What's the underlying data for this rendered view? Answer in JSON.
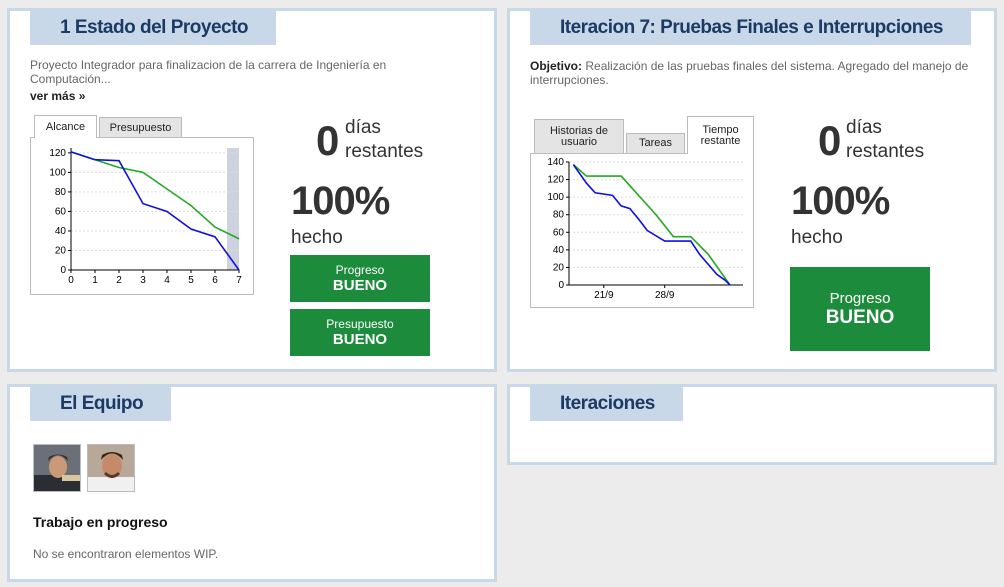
{
  "project_panel": {
    "title": "1 Estado del Proyecto",
    "description": "Proyecto Integrador para finalizacion de la carrera de Ingeniería en Computación...",
    "more_link": "ver más »",
    "tabs": [
      "Alcance",
      "Presupuesto"
    ],
    "active_tab": "Alcance",
    "days_number": "0",
    "days_label_1": "días",
    "days_label_2": "restantes",
    "percent": "100%",
    "percent_label": "hecho",
    "btn_progress": {
      "line1": "Progreso",
      "line2": "BUENO"
    },
    "btn_budget": {
      "line1": "Presupuesto",
      "line2": "BUENO"
    }
  },
  "iteration_panel": {
    "title": "Iteracion 7: Pruebas Finales e Interrupciones",
    "objective_label": "Objetivo:",
    "objective_text": "Realización de las pruebas finales del sistema. Agregado del manejo de interrupciones.",
    "tabs": [
      "Historias de usuario",
      "Tareas",
      "Tiempo restante"
    ],
    "active_tab": "Tiempo restante",
    "days_number": "0",
    "days_label_1": "días",
    "days_label_2": "restantes",
    "percent": "100%",
    "percent_label": "hecho",
    "btn_progress": {
      "line1": "Progreso",
      "line2": "BUENO"
    }
  },
  "team_panel": {
    "title": "El Equipo",
    "members": [
      "avatar-1",
      "avatar-2"
    ],
    "wip_title": "Trabajo en progreso",
    "wip_empty": "No se encontraron elementos WIP."
  },
  "iterations_panel": {
    "title": "Iteraciones"
  },
  "colors": {
    "panel_border": "#c8d8e8",
    "title_bg": "#c8d8e8",
    "title_text": "#1c3a64",
    "good_green": "#1c8c3c",
    "ideal_line": "#22aa22",
    "actual_line": "#1010dd"
  },
  "chart_data": [
    {
      "type": "line",
      "name": "Alcance",
      "x": [
        0,
        1,
        2,
        3,
        4,
        5,
        6,
        7
      ],
      "xticks": [
        "0",
        "1",
        "2",
        "3",
        "4",
        "5",
        "6",
        "7"
      ],
      "yticks": [
        "0",
        "20",
        "40",
        "60",
        "80",
        "100",
        "120"
      ],
      "ylim": [
        0,
        125
      ],
      "xlim": [
        0,
        7
      ],
      "highlight_x_range": [
        6.5,
        7
      ],
      "series": [
        {
          "color": "#22aa22",
          "x": [
            0,
            1,
            2,
            3,
            4,
            5,
            6,
            7
          ],
          "values": [
            121,
            113,
            105,
            100,
            83,
            66,
            44,
            32
          ]
        },
        {
          "color": "#1010dd",
          "x": [
            0,
            1,
            2,
            3,
            4,
            5,
            6,
            7
          ],
          "values": [
            121,
            113,
            112,
            68,
            60,
            42,
            34,
            0
          ]
        }
      ],
      "grid": true
    },
    {
      "type": "line",
      "name": "Tiempo restante",
      "xlim": [
        17,
        37
      ],
      "xticks_at": [
        21,
        28
      ],
      "xticks": [
        "21/9",
        "28/9"
      ],
      "yticks": [
        "0",
        "20",
        "40",
        "60",
        "80",
        "100",
        "120",
        "140"
      ],
      "ylim": [
        0,
        140
      ],
      "series": [
        {
          "color": "#22aa22",
          "x": [
            17.5,
            19,
            23,
            27,
            29,
            31,
            33,
            35.5
          ],
          "values": [
            137,
            124,
            124,
            80,
            55,
            55,
            35,
            0
          ]
        },
        {
          "color": "#1010dd",
          "x": [
            17.5,
            19,
            20,
            22,
            23,
            24,
            25,
            26,
            28,
            29,
            31,
            32,
            34,
            35,
            35.5
          ],
          "values": [
            137,
            116,
            105,
            102,
            90,
            87,
            75,
            62,
            50,
            50,
            50,
            35,
            12,
            5,
            0
          ]
        }
      ],
      "grid": true
    }
  ]
}
